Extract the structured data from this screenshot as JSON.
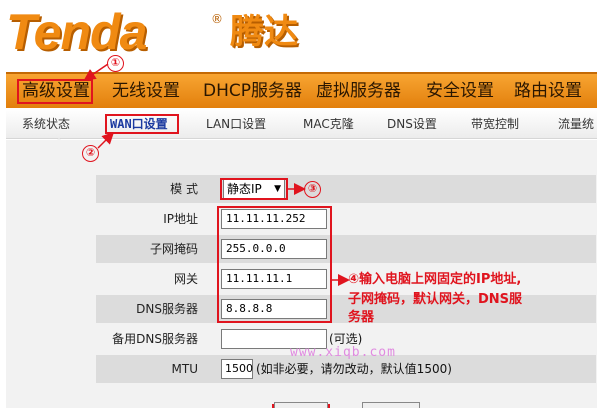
{
  "brand": {
    "logo_text": "Tenda",
    "logo_cn": "腾达",
    "reg_mark": "®"
  },
  "top_nav": [
    "高级设置",
    "无线设置",
    "DHCP服务器",
    "虚拟服务器",
    "安全设置",
    "路由设置"
  ],
  "sub_nav": [
    "系统状态",
    "WAN口设置",
    "LAN口设置",
    "MAC克隆",
    "DNS设置",
    "带宽控制",
    "流量统"
  ],
  "form": {
    "mode_label": "模    式",
    "mode_value": "静态IP",
    "ip_label": "IP地址",
    "ip_value": "11.11.11.252",
    "mask_label": "子网掩码",
    "mask_value": "255.0.0.0",
    "gateway_label": "网关",
    "gateway_value": "11.11.11.1",
    "dns_label": "DNS服务器",
    "dns_value": "8.8.8.8",
    "dns2_label": "备用DNS服务器",
    "dns2_value": "",
    "dns2_hint": "(可选)",
    "mtu_label": "MTU",
    "mtu_value": "1500",
    "mtu_hint": "(如非必要，请勿改动，默认值1500)"
  },
  "annotations": {
    "n1": "①",
    "n2": "②",
    "n3": "③",
    "n4": "④",
    "step4_line1": "输入电脑上网固定的IP地址,",
    "step4_line2": "子网掩码，默认网关，DNS服",
    "step4_line3": "务器"
  },
  "watermark": "www.xiqb.com",
  "colors": {
    "accent": "#f08a12",
    "annotation_red": "#e0141e",
    "active_tab": "#1c3aa0"
  }
}
